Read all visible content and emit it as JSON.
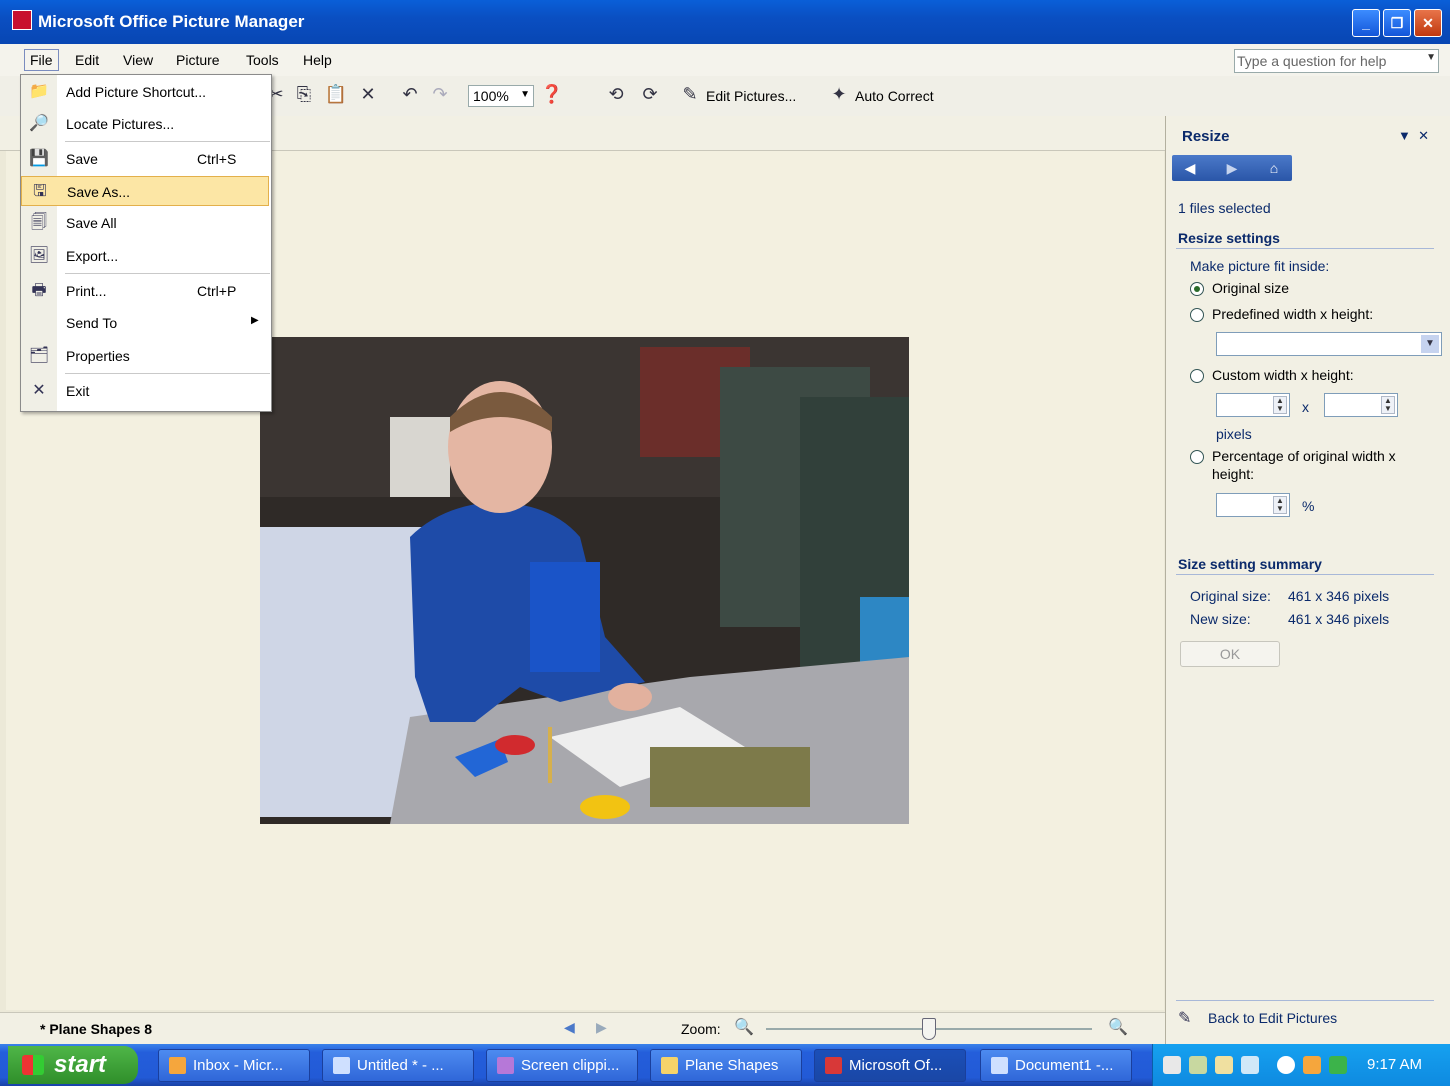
{
  "window": {
    "title": "Microsoft Office Picture Manager"
  },
  "menubar": {
    "items": [
      "File",
      "Edit",
      "View",
      "Picture",
      "Tools",
      "Help"
    ],
    "help_placeholder": "Type a question for help"
  },
  "toolbar": {
    "zoom_value": "100%",
    "edit_pictures": "Edit Pictures...",
    "auto_correct": "Auto Correct"
  },
  "file_menu": {
    "items": [
      {
        "label": "Add Picture Shortcut...",
        "shortcut": ""
      },
      {
        "label": "Locate Pictures...",
        "shortcut": ""
      },
      {
        "label": "Save",
        "shortcut": "Ctrl+S"
      },
      {
        "label": "Save As...",
        "shortcut": "",
        "highlighted": true
      },
      {
        "label": "Save All",
        "shortcut": ""
      },
      {
        "label": "Export...",
        "shortcut": ""
      },
      {
        "label": "Print...",
        "shortcut": "Ctrl+P"
      },
      {
        "label": "Send To",
        "shortcut": "",
        "submenu": true
      },
      {
        "label": "Properties",
        "shortcut": ""
      },
      {
        "label": "Exit",
        "shortcut": ""
      }
    ]
  },
  "status": {
    "filename": "* Plane Shapes 8",
    "zoom_label": "Zoom:",
    "zoom_level": 0.5
  },
  "pane": {
    "title": "Resize",
    "files_selected": "1 files selected",
    "resize_settings": "Resize settings",
    "fit_inside": "Make picture fit inside:",
    "opt_original": "Original size",
    "opt_predefined": "Predefined width x height:",
    "opt_custom": "Custom width x height:",
    "x_sep": "x",
    "pixels": "pixels",
    "opt_percent_1": "Percentage of original width x",
    "opt_percent_2": "height:",
    "percent_sign": "%",
    "summary_title": "Size setting summary",
    "orig_label": "Original size:",
    "orig_value": "461 x 346 pixels",
    "new_label": "New size:",
    "new_value": "461 x 346 pixels",
    "ok": "OK",
    "back": "Back to Edit Pictures"
  },
  "taskbar": {
    "start": "start",
    "tasks": [
      "Inbox - Micr...",
      "Untitled * - ...",
      "Screen clippi...",
      "Plane Shapes",
      "Microsoft Of...",
      "Document1 -..."
    ],
    "clock": "9:17 AM"
  },
  "colors": {
    "title_blue": "#0a4fc2",
    "pane_text": "#0b2a6b",
    "menu_highlight": "#fce6a5"
  }
}
